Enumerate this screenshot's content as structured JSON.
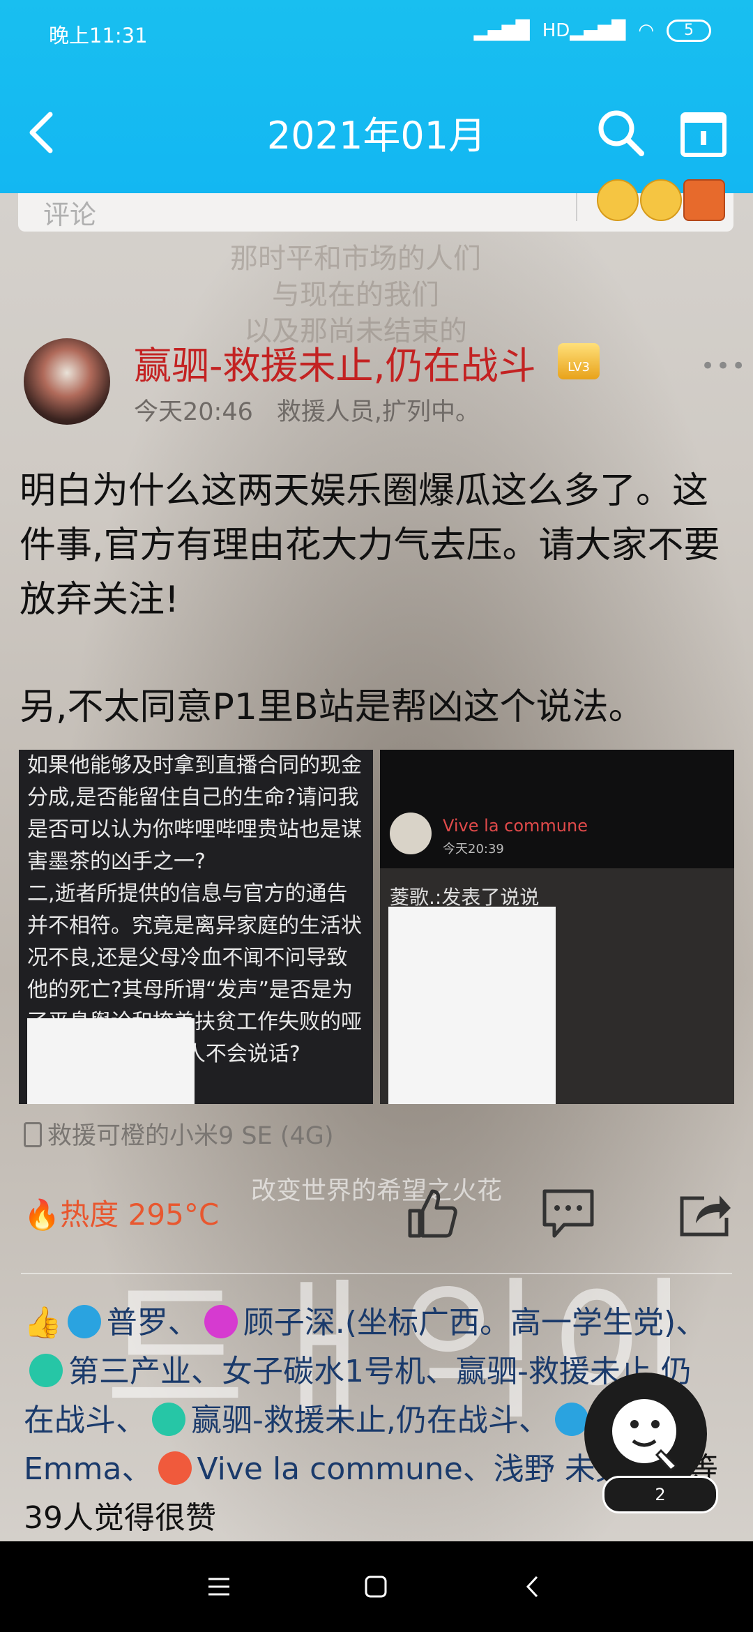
{
  "status_bar": {
    "time": "晚上11:31",
    "signal": "HD",
    "battery": "5"
  },
  "header": {
    "title": "2021年01月"
  },
  "comment_box": {
    "placeholder": "评论"
  },
  "background_text": {
    "line1": "那时平和市场的人们",
    "line2": "与现在的我们",
    "line3": "以及那尚未结束的",
    "slogan": "改变世界的希望之火花"
  },
  "post": {
    "username": "赢驷-救援未止,仍在战斗",
    "level": "LV3",
    "time": "今天20:46",
    "status": "救援人员,扩列中。",
    "body_p1": "明白为什么这两天娱乐圈爆瓜这么多了。这件事,官方有理由花大力气去压。请大家不要放弃关注!",
    "body_p2": "另,不太同意P1里B站是帮凶这个说法。",
    "image1_text": "如果他能够及时拿到直播合同的现金分成,是否能留住自己的生命?请问我是否可以认为你哔哩哔哩贵站也是谋害墨茶的凶手之一?\n二,逝者所提供的信息与官方的通告并不相符。究竟是离异家庭的生活状况不良,还是父母冷血不闻不问导致他的死亡?其母所谓“发声”是否是为了平息舆论和掩盖扶贫工作失败的哑炮?是不是欺负死人不会说话?\n收起",
    "image2_name": "Vive la commune",
    "image2_time": "今天20:39",
    "image2_desc": "菱歌.:发表了说说",
    "device": "救援可橙的小米9 SE (4G)",
    "heat": "热度 295°C"
  },
  "likes": {
    "names_1": "普罗、",
    "names_2": "顾子深.(坐标广西。高一学生党)、",
    "names_3": "第三产业、女子碳水1号机、赢驷-救援未止,仍在战斗、",
    "names_4": "赢驷-救援未止,仍在战斗、",
    "names_5": "、Emma、",
    "names_6": "Vive la commune、浅野 未央@",
    "names_7": "荣等39人觉得很赞"
  },
  "float_button": {
    "count": "2"
  },
  "colors": {
    "header_bg": "#19bff0",
    "username": "#c32222",
    "heat": "#e8572f",
    "like_names": "#1a3a6b"
  },
  "icons": [
    "back-icon",
    "search-icon",
    "calendar-icon",
    "more-icon",
    "like-icon",
    "comment-icon",
    "share-icon",
    "fire-icon",
    "phone-icon",
    "nav-menu-icon",
    "nav-home-icon",
    "nav-back-icon"
  ]
}
